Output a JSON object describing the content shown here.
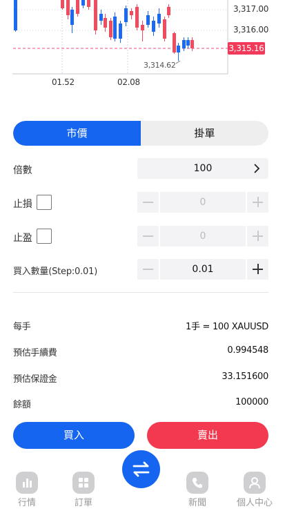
{
  "chart": {
    "price_ticks": [
      "3,317.00",
      "3,316.00"
    ],
    "current_price": "3,315.16",
    "low_label": "3,314.62",
    "time_ticks": [
      "01.52",
      "02.08"
    ],
    "colors": {
      "up": "#f04b5e",
      "down": "#1d6af2",
      "current_line": "#ee4a85"
    }
  },
  "tabs": [
    {
      "label": "市價",
      "active": true
    },
    {
      "label": "掛單",
      "active": false
    }
  ],
  "form": {
    "multiplier_label": "倍數",
    "multiplier_value": "100",
    "stop_loss_label": "止損",
    "stop_loss_value": "0",
    "take_profit_label": "止盈",
    "take_profit_value": "0",
    "quantity_label": "買入數量(Step:0.01)",
    "quantity_value": "0.01"
  },
  "info": [
    {
      "label": "每手",
      "value": "1手 = 100 XAUUSD"
    },
    {
      "label": "預估手續費",
      "value": "0.994548"
    },
    {
      "label": "預估保證金",
      "value": "33.151600"
    },
    {
      "label": "餘額",
      "value": "100000"
    }
  ],
  "actions": {
    "buy_label": "買入",
    "sell_label": "賣出"
  },
  "nav": [
    {
      "label": "行情",
      "icon": "chart-bar-icon"
    },
    {
      "label": "訂單",
      "icon": "grid-icon"
    },
    {
      "label": "新聞",
      "icon": "phone-icon"
    },
    {
      "label": "個人中心",
      "icon": "user-icon"
    }
  ],
  "center_icon": "swap-arrows-icon"
}
